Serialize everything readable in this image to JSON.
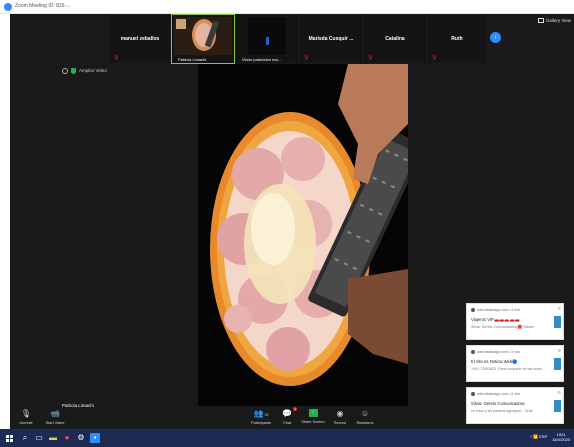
{
  "window": {
    "title": "Zoom Meeting ID: 826-..."
  },
  "strip": {
    "participants": [
      {
        "name": "manuel zeballos",
        "muted": true,
        "video": false
      },
      {
        "name": "Patricia Limachi",
        "muted": false,
        "video": true,
        "active": true
      },
      {
        "name": "Victor palavicino ma...",
        "muted": true,
        "video": true
      },
      {
        "name": "Marisda Cusquir ...",
        "muted": true,
        "video": false
      },
      {
        "name": "Catalina",
        "muted": true,
        "video": false
      },
      {
        "name": "Ruth",
        "muted": true,
        "video": false
      }
    ],
    "next_icon": "chevron-right-icon",
    "gallery_label": "Gallery View"
  },
  "status": {
    "label": "Ampliar Video"
  },
  "speaker": {
    "name": "Patricia Limachi"
  },
  "notifications": [
    {
      "source": "web.whatsapp.com • 3 min",
      "title": "Viajeros VIP🚗🚗🚗🚗🚗",
      "body": "Silvia: Gerelo Comunicadora 🟥 Sticker"
    },
    {
      "source": "web.whatsapp.com • 3 min",
      "title": "El Alto es Noticia Web🔵",
      "body": "+591 72501823: Para compartir en las redes"
    },
    {
      "source": "web.whatsapp.com • 3 min",
      "title": "Silvia- Gerelo Comunicadora",
      "body": "en fotos y las parares agregado · Grab"
    }
  ],
  "toolbar": {
    "unmute": "Unmute",
    "start_video": "Start Video",
    "participants": "Participants",
    "participants_count": "33",
    "chat": "Chat",
    "chat_badge": "1",
    "share": "Share Screen",
    "record": "Record",
    "reactions": "Reactions"
  },
  "taskbar": {
    "time": "1921",
    "date": "18/4/2020",
    "lang": "ESP"
  },
  "colors": {
    "accent": "#2d8cff",
    "share_green": "#23b14d",
    "mute_red": "#e02828",
    "taskbar": "#1c2a54"
  }
}
